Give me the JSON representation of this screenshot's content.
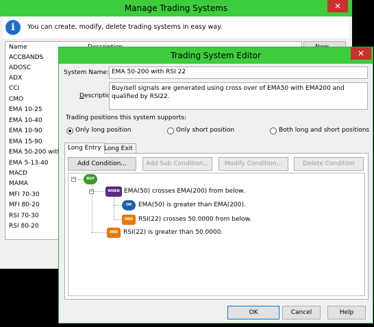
{
  "manager": {
    "title": "Manage Trading Systems",
    "info": "You can create, modify, delete trading systems in easy way.",
    "columns": {
      "name": "Name",
      "description": "Description"
    },
    "systems": [
      "ACCBANDS",
      "ADOSC",
      "ADX",
      "CCI",
      "CMO",
      "EMA 10-25",
      "EMA 10-40",
      "EMA 10-90",
      "EMA 15-90",
      "EMA 50-200 with",
      "EMA 5-13-40",
      "MACD",
      "MAMA",
      "MFI 70-30",
      "MFI 80-20",
      "RSI 70-30",
      "RSI 80-20"
    ],
    "new_button": "New..."
  },
  "editor": {
    "title": "Trading System Editor",
    "name_label": "System Name:",
    "name_value": "EMA 50-200 with RSI 22",
    "desc_label": "Description:",
    "desc_value": "Buy/sell signals are generated using cross over of EMA50 with EMA200 and qualified by RSI22.",
    "positions_label": "Trading positions this system supports:",
    "radios": [
      "Only long position",
      "Only short position",
      "Both long and short positions"
    ],
    "tabs": [
      "Long Entry",
      "Long Exit"
    ],
    "buttons": [
      "Add Condition...",
      "Add Sub Condition...",
      "Modify Condition...",
      "Delete Condition"
    ],
    "tree": {
      "root": "BUY",
      "when": "WHEN",
      "or": "OR",
      "and": "AND",
      "cond1": "EMA(50) crosses EMA(200) from below.",
      "cond2": "EMA(50) is greater than EMA(200).",
      "cond3": "RSI(22) crosses 50.0000 from below.",
      "cond4": "RSI(22) is greater than 50.0000."
    },
    "ok": "OK",
    "cancel": "Cancel",
    "help": "Help",
    "colors": {
      "accent": "#3ccc3c",
      "buy": "#3c9a2a",
      "when": "#5a2d82",
      "or": "#1f5fa8",
      "and": "#e8780a"
    }
  }
}
